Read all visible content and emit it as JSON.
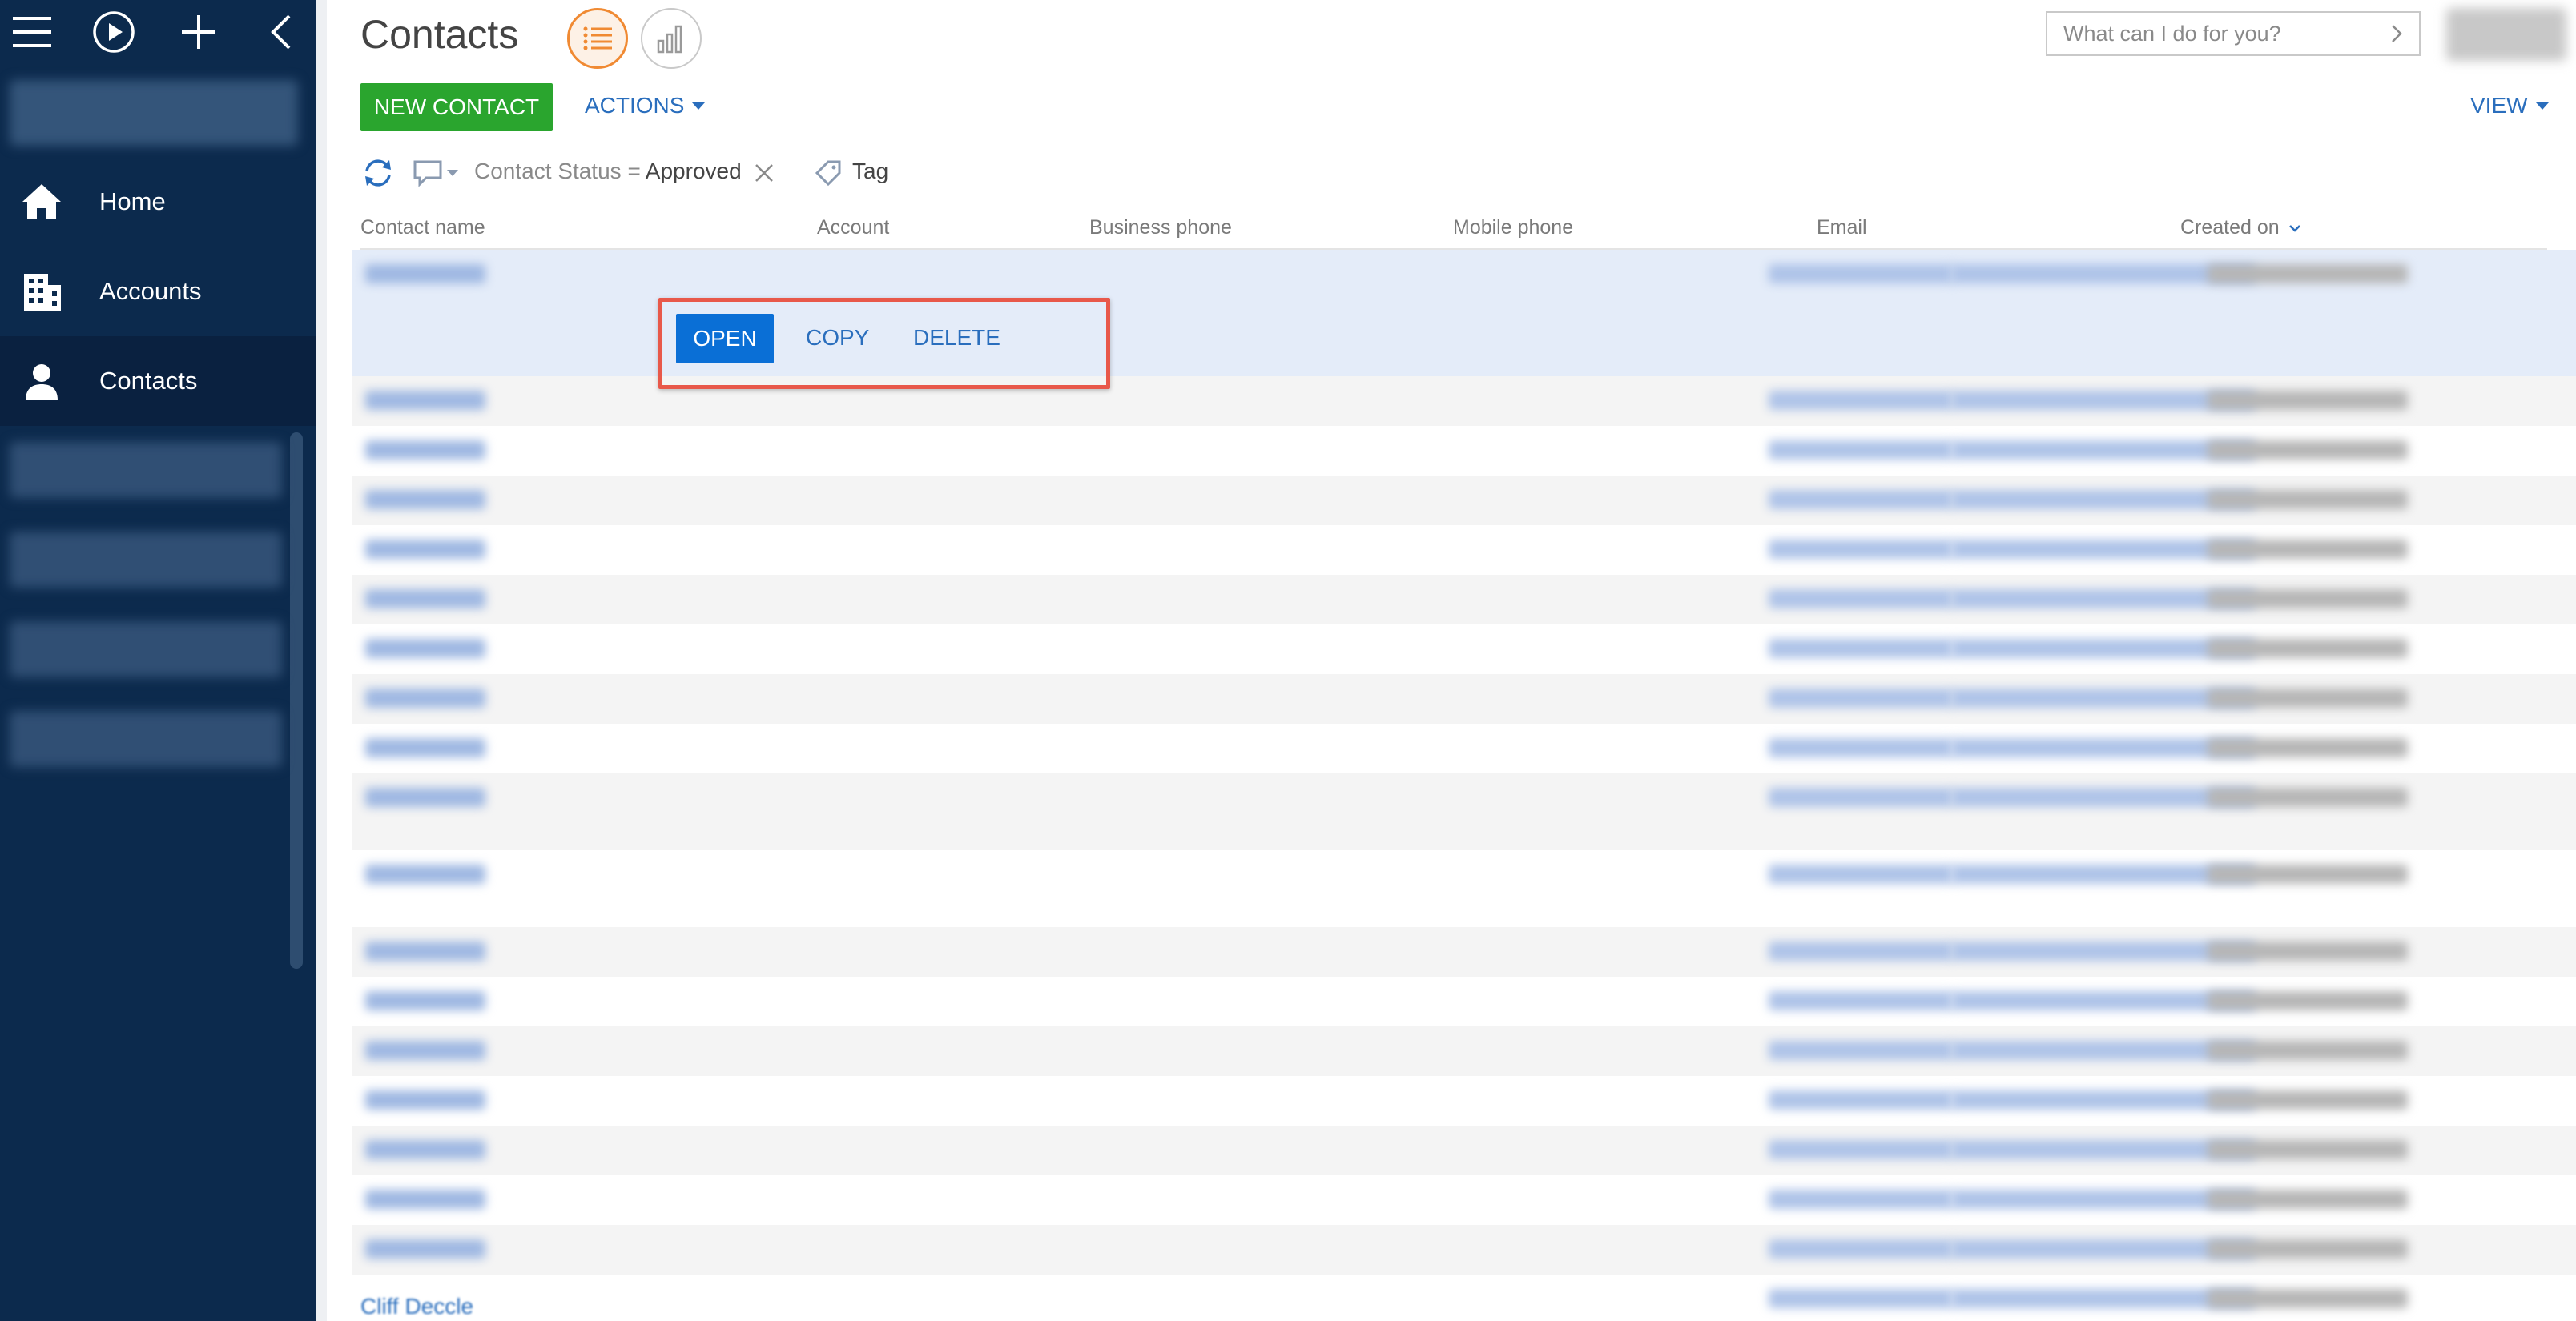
{
  "sidebar": {
    "nav": [
      {
        "label": "Home"
      },
      {
        "label": "Accounts"
      },
      {
        "label": "Contacts"
      }
    ]
  },
  "header": {
    "title": "Contacts",
    "search_placeholder": "What can I do for you?"
  },
  "toolbar": {
    "new_contact": "NEW CONTACT",
    "actions": "ACTIONS",
    "view": "VIEW"
  },
  "filter": {
    "field": "Contact Status",
    "operator": "=",
    "value": "Approved",
    "tag_label": "Tag"
  },
  "table": {
    "columns": [
      "Contact name",
      "Account",
      "Business phone",
      "Mobile phone",
      "Email",
      "Created on"
    ]
  },
  "row_actions": {
    "open": "OPEN",
    "copy": "COPY",
    "delete": "DELETE"
  },
  "last_row_name": "Cliff Deccle",
  "colors": {
    "sidebar_bg": "#0c2a4d",
    "primary_green": "#2aa52e",
    "primary_blue": "#0a6fd6",
    "link_blue": "#2a6ebd",
    "accent_orange": "#f08a33",
    "highlight_red": "#e8584a"
  }
}
